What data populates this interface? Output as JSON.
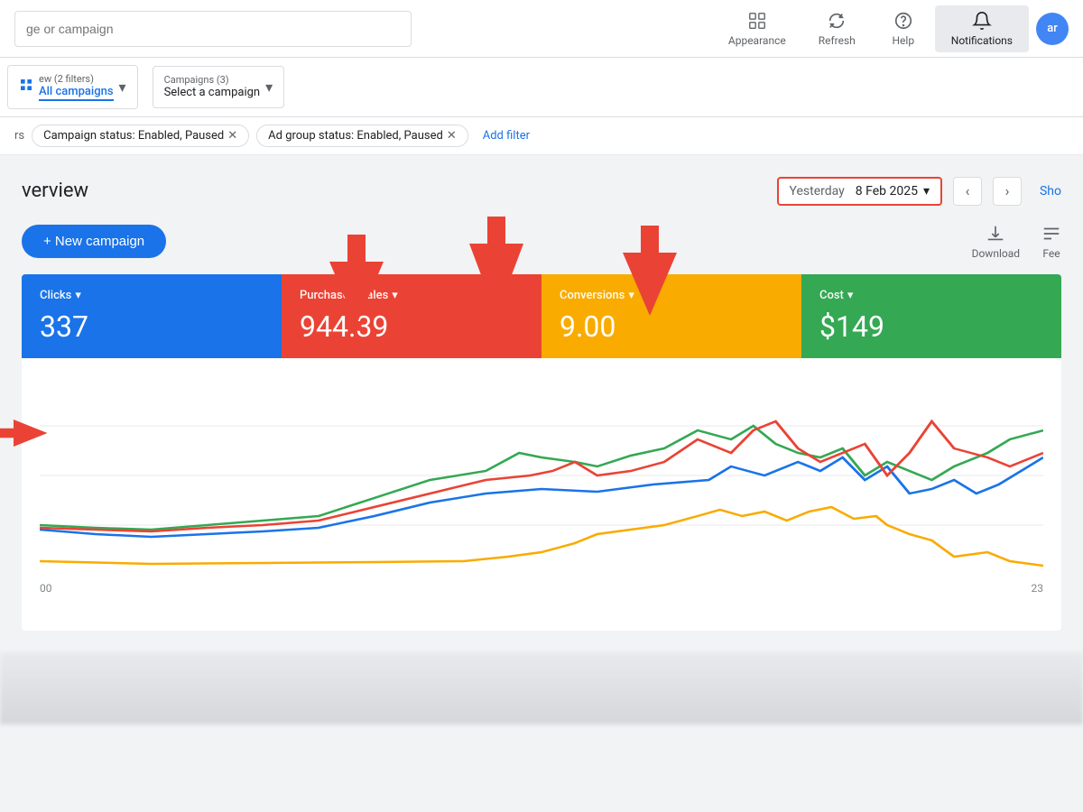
{
  "topNav": {
    "searchPlaceholder": "ge or campaign",
    "icons": [
      {
        "id": "appearance",
        "label": "Appearance",
        "unicode": "🖼"
      },
      {
        "id": "refresh",
        "label": "Refresh",
        "unicode": "↻"
      },
      {
        "id": "help",
        "label": "Help",
        "unicode": "?"
      },
      {
        "id": "notifications",
        "label": "Notifications",
        "unicode": "🔔",
        "active": true
      }
    ],
    "userInitials": "ar"
  },
  "filterRow": {
    "dropdowns": [
      {
        "id": "view",
        "label": "All campaigns",
        "prefix": "ew (2 filters)"
      },
      {
        "id": "campaign",
        "label": "Select a campaign",
        "prefix": "Campaigns (3)"
      }
    ],
    "tabs": [
      {
        "id": "all",
        "label": "All campaigns",
        "active": true
      }
    ]
  },
  "activeFilters": [
    {
      "id": "campaign-status",
      "label": "Campaign status: Enabled, Paused"
    },
    {
      "id": "adgroup-status",
      "label": "Ad group status: Enabled, Paused"
    }
  ],
  "addFilterLabel": "Add filter",
  "overview": {
    "title": "verview",
    "dateLabel": "Yesterday",
    "dateValue": "8 Feb 2025",
    "showLabel": "Sho"
  },
  "actions": {
    "newCampaignLabel": "+ New campaign",
    "downloadLabel": "Download",
    "feedLabel": "Fee"
  },
  "metrics": [
    {
      "id": "clicks",
      "label": "Clicks",
      "value": "337",
      "color": "blue"
    },
    {
      "id": "purchases",
      "label": "Purchases/Sales",
      "value": "944.39",
      "color": "red"
    },
    {
      "id": "conversions",
      "label": "Conversions",
      "value": "9.00",
      "color": "yellow"
    },
    {
      "id": "cost",
      "label": "Cost",
      "value": "$149",
      "color": "green"
    }
  ],
  "chart": {
    "xLabels": [
      "00",
      "23"
    ],
    "lines": [
      {
        "id": "blue",
        "color": "#1a73e8"
      },
      {
        "id": "green",
        "color": "#34a853"
      },
      {
        "id": "red",
        "color": "#ea4335"
      },
      {
        "id": "yellow",
        "color": "#f9ab00"
      }
    ]
  }
}
